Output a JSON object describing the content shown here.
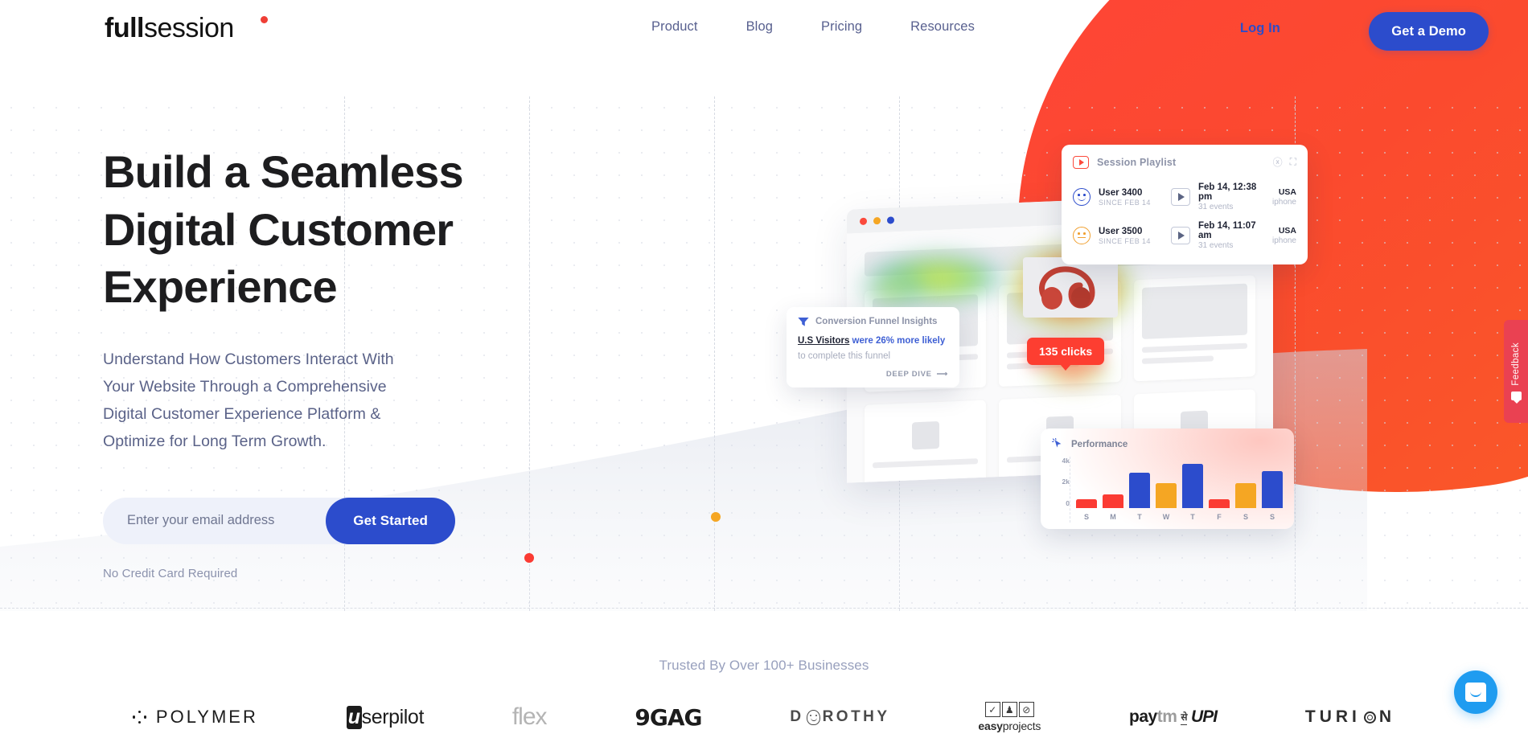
{
  "brand": {
    "logo_bold": "full",
    "logo_light": "session",
    "accent_red": "#ef3e36",
    "accent_blue": "#2c4ccc",
    "accent_orange": "#f0a030"
  },
  "header": {
    "nav": [
      {
        "label": "Product"
      },
      {
        "label": "Blog"
      },
      {
        "label": "Pricing"
      },
      {
        "label": "Resources"
      }
    ],
    "login_label": "Log In",
    "demo_label": "Get a Demo"
  },
  "hero": {
    "headline_line1": "Build a Seamless",
    "headline_line2": "Digital Customer",
    "headline_line3": "Experience",
    "subtitle": "Understand How Customers Interact With Your Website Through a Comprehensive Digital Customer Experience Platform & Optimize for Long Term Growth.",
    "email_placeholder": "Enter your email address",
    "email_value": "",
    "cta_label": "Get Started",
    "disclaimer": "No Credit Card Required"
  },
  "playlist": {
    "title": "Session Playlist",
    "icon": "video-play-icon",
    "action_download": "download-icon",
    "action_expand": "expand-icon",
    "rows": [
      {
        "user": "User 3400",
        "since": "SINCE FEB 14",
        "mood": "happy",
        "time": "Feb 14, 12:38 pm",
        "events": "31 events",
        "country": "USA",
        "device": "iphone"
      },
      {
        "user": "User 3500",
        "since": "SINCE FEB 14",
        "mood": "neutral",
        "time": "Feb 14, 11:07 am",
        "events": "31 events",
        "country": "USA",
        "device": "iphone"
      }
    ]
  },
  "funnel": {
    "icon": "filter-funnel-icon",
    "title": "Conversion Funnel Insights",
    "stat_subject": "U.S Visitors",
    "stat_highlight": "were 26% more likely",
    "stat_tail": "to complete this funnel",
    "cta": "DEEP DIVE"
  },
  "heatmap": {
    "clicks_badge": "135 clicks"
  },
  "performance": {
    "icon": "click-cursor-icon",
    "title": "Performance"
  },
  "chart_data": {
    "type": "bar",
    "title": "Performance",
    "categories": [
      "S",
      "M",
      "T",
      "W",
      "T",
      "F",
      "S",
      "S"
    ],
    "values": [
      1000,
      1600,
      4100,
      2900,
      5200,
      1000,
      2900,
      4300
    ],
    "colors": [
      "#fb3b33",
      "#fb3b33",
      "#2c4ccc",
      "#f5a623",
      "#2c4ccc",
      "#fb3b33",
      "#f5a623",
      "#2c4ccc"
    ],
    "ytick_labels": [
      "4k",
      "2k",
      "0"
    ],
    "ytick_values": [
      4000,
      2000,
      0
    ],
    "ylim": [
      0,
      6000
    ],
    "xlabel": "",
    "ylabel": "",
    "grid": false,
    "legend": false
  },
  "feedback": {
    "label": "Feedback",
    "icon": "speech-bubble-icon",
    "color": "#ea4152"
  },
  "trusted": {
    "heading": "Trusted By Over 100+ Businesses",
    "logos": [
      {
        "name": "POLYMER"
      },
      {
        "name": "userpilot"
      },
      {
        "name": "flex"
      },
      {
        "name": "9GAG"
      },
      {
        "name": "DOROTHY"
      },
      {
        "name": "easyprojects"
      },
      {
        "name": "Paytm UPI"
      },
      {
        "name": "TURION"
      }
    ],
    "polymer_text": "POLYMER",
    "userpilot_u": "u",
    "userpilot_rest": "serpilot",
    "flex_text": "flex",
    "ninegag_text": "9GAG",
    "dorothy_pre": "D",
    "dorothy_post": "ROTHY",
    "easy_bold": "easy",
    "easy_light": "projects",
    "paytm_pay": "pay",
    "paytm_tm": "tm",
    "paytm_se": "से",
    "paytm_upi": "UPI",
    "turion_pre": "TURI",
    "turion_post": "N"
  },
  "chat": {
    "icon": "intercom-chat-icon"
  }
}
